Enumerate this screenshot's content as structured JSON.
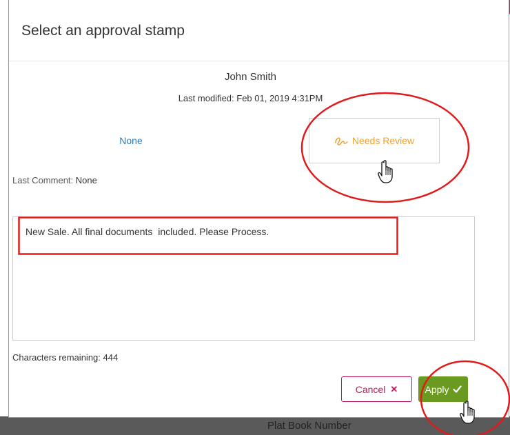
{
  "dialog": {
    "title": "Select an approval stamp"
  },
  "user": {
    "name": "John Smith",
    "last_modified": "Last modified: Feb 01, 2019 4:31PM"
  },
  "stamps": {
    "none_label": "None",
    "review_label": "Needs Review",
    "review_icon": "signature-icon"
  },
  "last_comment": {
    "label": "Last Comment:",
    "value": "None"
  },
  "comment": {
    "text": "New Sale. All final documents  included. Please Process."
  },
  "characters_remaining": "Characters remaining: 444",
  "buttons": {
    "cancel_label": "Cancel",
    "cancel_icon": "close-icon",
    "apply_label": "Apply",
    "apply_icon": "checkmark-icon"
  },
  "background": {
    "partial_label": "Plat Book Number"
  },
  "colors": {
    "link": "#2a7ab8",
    "needs_review": "#f0a030",
    "cancel": "#c2185b",
    "apply": "#6a9a1f",
    "annotation": "#e01b1b"
  }
}
